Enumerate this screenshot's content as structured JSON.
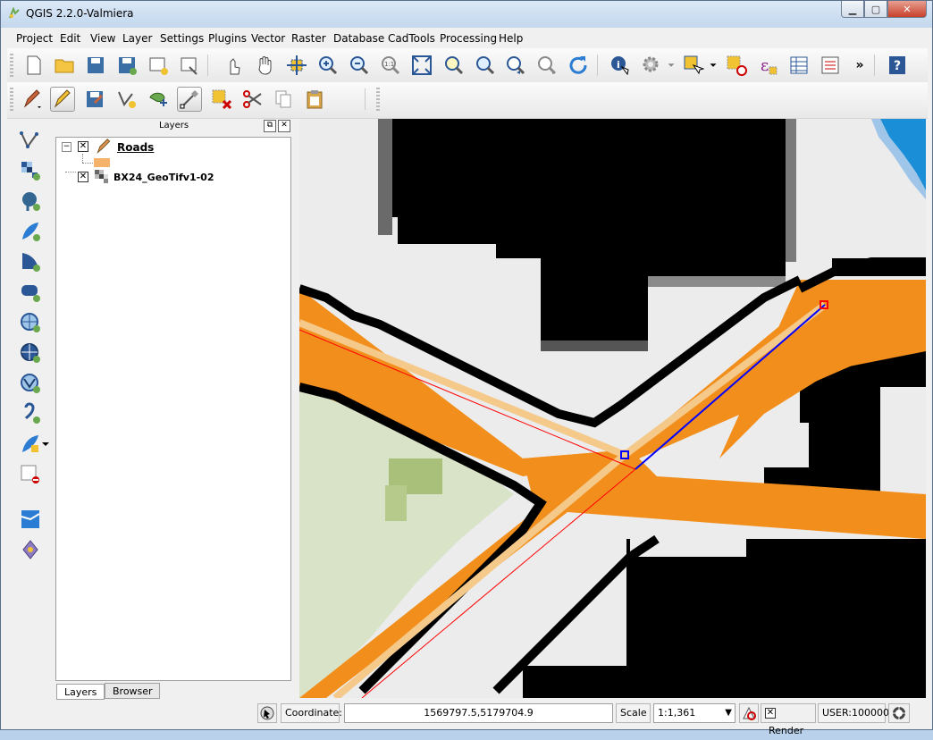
{
  "window": {
    "title": "QGIS 2.2.0-Valmiera"
  },
  "menubar": {
    "items": [
      "Project",
      "Edit",
      "View",
      "Layer",
      "Settings",
      "Plugins",
      "Vector",
      "Raster",
      "Database",
      "CadTools",
      "Processing",
      "Help"
    ]
  },
  "toolbar1": {
    "overflow": "»"
  },
  "layers_panel": {
    "title": "Layers",
    "layers": [
      {
        "name": "Roads",
        "checked": true,
        "icon": "pencil-edit-icon",
        "legend_color": "#f5b26b"
      },
      {
        "name": "BX24_GeoTifv1-02",
        "checked": true,
        "icon": "raster-icon"
      }
    ],
    "tabs": [
      "Layers",
      "Browser"
    ]
  },
  "status": {
    "coordinate_label": "Coordinate:",
    "coordinate_value": "1569797.5,5179704.9",
    "scale_label": "Scale",
    "scale_value": "1:1,361",
    "render_label": "Render",
    "crs": "USER:100000"
  },
  "colors": {
    "road_orange": "#f28f1c",
    "road_centerline": "#f5c98a",
    "black": "#000000",
    "light_gray": "#ececec",
    "green": "#d8e3c8",
    "blue_line": "#0000ff",
    "red_line": "#ff0000",
    "water": "#1a8fd8"
  }
}
